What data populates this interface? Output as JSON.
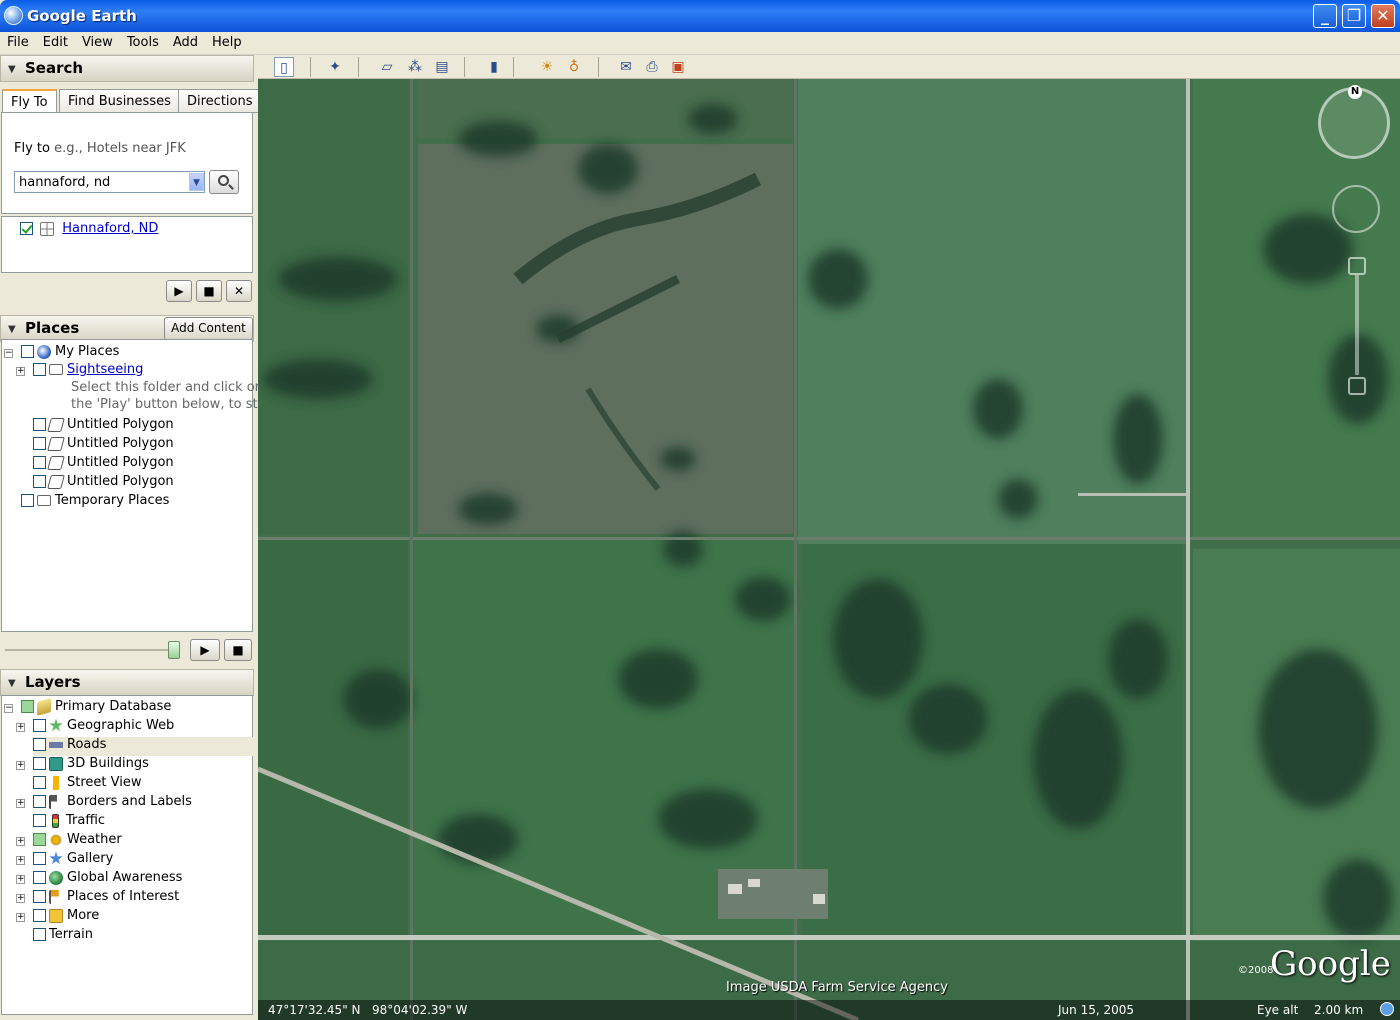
{
  "window": {
    "title": "Google Earth",
    "minimize": "_",
    "maximize": "❐",
    "close": "✕"
  },
  "menu": [
    "File",
    "Edit",
    "View",
    "Tools",
    "Add",
    "Help"
  ],
  "search": {
    "title": "Search",
    "tabs": [
      "Fly To",
      "Find Businesses",
      "Directions"
    ],
    "flyto_label": "Fly to",
    "flyto_hint": "e.g., Hotels near JFK",
    "input_value": "hannaford, nd",
    "result": "Hannaford, ND"
  },
  "places": {
    "title": "Places",
    "add_content": "Add Content",
    "items": {
      "my_places": "My Places",
      "sightseeing": "Sightseeing",
      "hint1": "Select this folder and click on",
      "hint2": "the 'Play' button below, to start",
      "poly": "Untitled Polygon",
      "temporary": "Temporary Places"
    }
  },
  "layers": {
    "title": "Layers",
    "items": [
      "Primary Database",
      "Geographic Web",
      "Roads",
      "3D Buildings",
      "Street View",
      "Borders and Labels",
      "Traffic",
      "Weather",
      "Gallery",
      "Global Awareness",
      "Places of Interest",
      "More",
      "Terrain"
    ]
  },
  "map": {
    "coords_lat": "47°17'32.45\" N",
    "coords_lon": "98°04'02.39\" W",
    "date": "Jun 15, 2005",
    "eye_alt_label": "Eye alt",
    "eye_alt_value": "2.00 km",
    "attribution": "Image USDA Farm Service Agency",
    "copyright": "©2008",
    "logo": "Google",
    "compass_north": "N"
  }
}
